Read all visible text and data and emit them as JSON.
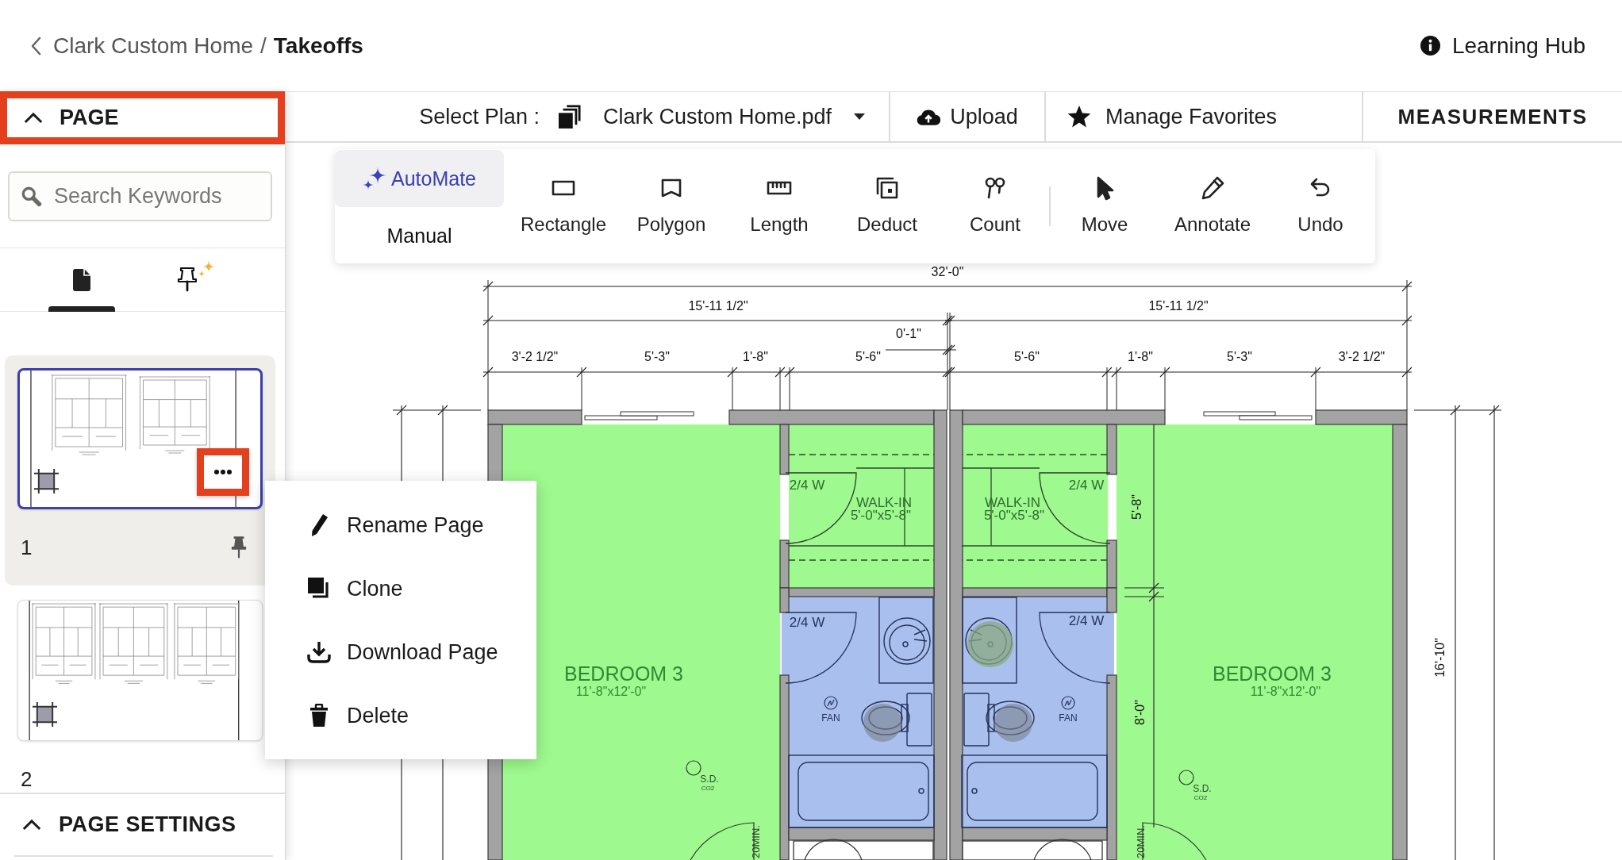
{
  "header": {
    "breadcrumb": {
      "parent": "Clark Custom Home",
      "separator": "/",
      "current": "Takeoffs"
    },
    "help_link": {
      "label": "Learning Hub"
    }
  },
  "sidebar": {
    "page_section": {
      "title": "PAGE",
      "expanded": true,
      "highlighted": true
    },
    "search": {
      "placeholder": "Search Keywords"
    },
    "tabs": [
      {
        "kind": "pages",
        "selected": true
      },
      {
        "kind": "pinned",
        "selected": false
      }
    ],
    "pages": [
      {
        "number": "1",
        "kind": "double",
        "selected": true,
        "pinned": true,
        "menu_button": true,
        "menu_highlighted": true
      },
      {
        "number": "2",
        "kind": "triple",
        "selected": false,
        "pinned": false,
        "menu_button": false
      }
    ],
    "settings_section": {
      "title": "PAGE SETTINGS",
      "expanded": true
    }
  },
  "context_menu": {
    "items": [
      {
        "kind": "rename",
        "label": "Rename Page"
      },
      {
        "kind": "clone",
        "label": "Clone"
      },
      {
        "kind": "download",
        "label": "Download Page"
      },
      {
        "kind": "delete",
        "label": "Delete"
      }
    ]
  },
  "plan_bar": {
    "select_label": "Select Plan :",
    "plan_name": "Clark Custom Home.pdf",
    "actions": [
      {
        "kind": "upload",
        "label": "Upload"
      },
      {
        "kind": "favorites",
        "label": "Manage Favorites"
      }
    ],
    "panel_tab": "MEASUREMENTS"
  },
  "tool_palette": {
    "modes": [
      {
        "kind": "automate",
        "label": "AutoMate",
        "selected": true
      },
      {
        "kind": "manual",
        "label": "Manual",
        "selected": false
      }
    ],
    "tool_groups": [
      [
        {
          "kind": "rectangle",
          "label": "Rectangle"
        },
        {
          "kind": "polygon",
          "label": "Polygon"
        },
        {
          "kind": "length",
          "label": "Length"
        },
        {
          "kind": "deduct",
          "label": "Deduct"
        },
        {
          "kind": "count",
          "label": "Count"
        }
      ],
      [
        {
          "kind": "move",
          "label": "Move"
        },
        {
          "kind": "annotate",
          "label": "Annotate"
        },
        {
          "kind": "undo",
          "label": "Undo"
        }
      ]
    ]
  },
  "plan": {
    "areas": [
      {
        "color": "#9ef98e"
      },
      {
        "color": "#9ef98e"
      },
      {
        "color": "#a9c0ef"
      },
      {
        "color": "#9ef98e"
      },
      {
        "color": "#a9c0ef"
      },
      {
        "color": "#9ef98e"
      }
    ],
    "dimension_labels": [
      "32'-0\"",
      "15'-11 1/2\"",
      "15'-11 1/2\"",
      "0'-1\"",
      "3'-2 1/2\"",
      "5'-3\"",
      "1'-8\"",
      "5'-6\"",
      "5'-6\"",
      "1'-8\"",
      "5'-3\"",
      "3'-2 1/2\"",
      "5'-8\"",
      "8'-0\"",
      "16'-10\""
    ],
    "rooms": [
      {
        "name": "BEDROOM 3",
        "size": "11'-8\"x12'-0\""
      },
      {
        "name": "WALK-IN",
        "size": "5'-0\"x5'-8\""
      },
      {
        "name": "WALK-IN",
        "size": "5'-0\"x5'-8\""
      },
      {
        "name": "BEDROOM 3",
        "size": "11'-8\"x12'-0\""
      }
    ],
    "door_labels": [
      "2/4 W",
      "2/4 W",
      "2/4 W",
      "2/4 W"
    ],
    "fans": [
      {
        "label": "FAN"
      },
      {
        "label": "FAN"
      }
    ],
    "detectors": [
      {
        "label": "S.D.",
        "sub": "CO2"
      },
      {
        "label": "S.D.",
        "sub": "CO2"
      }
    ],
    "clearance_labels": [
      "20MIN.",
      "20MIN."
    ]
  }
}
